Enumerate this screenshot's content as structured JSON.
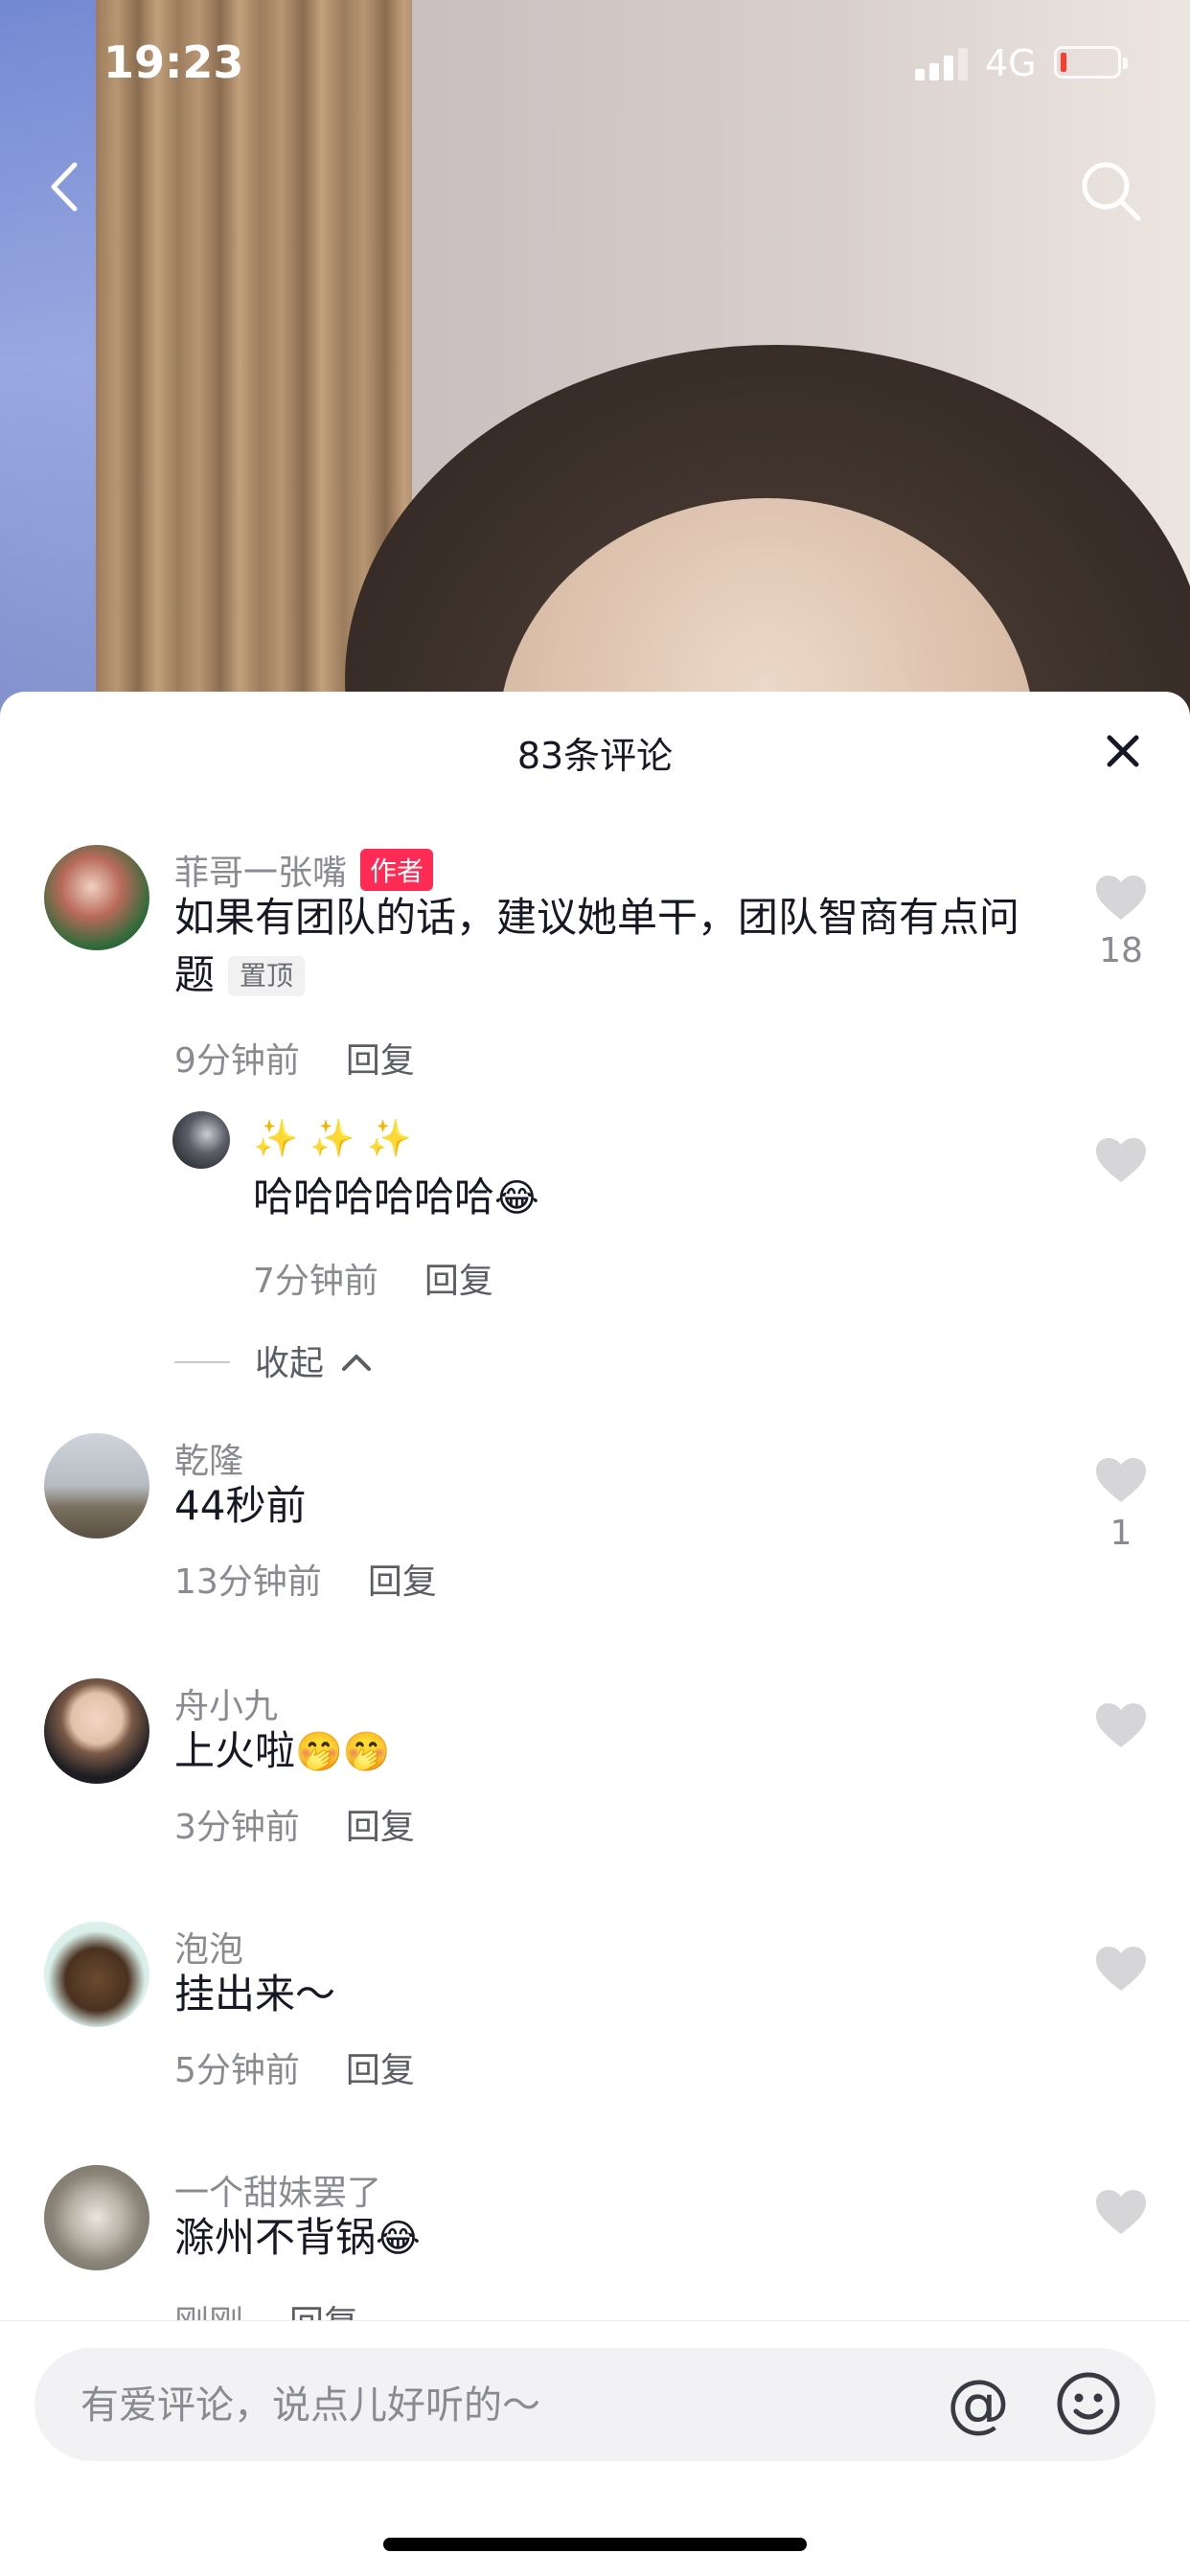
{
  "status_bar": {
    "time": "19:23",
    "network": "4G",
    "battery_level": 0.08,
    "battery_color": "#ff3b30"
  },
  "nav": {
    "back_icon": "chevron-left-icon",
    "search_icon": "search-icon"
  },
  "comments_panel": {
    "title": "83条评论",
    "close_icon": "close-icon",
    "collapse_label": "收起",
    "reply_label": "回复",
    "comments": [
      {
        "name": "菲哥一张嘴",
        "author_badge": "作者",
        "text": "如果有团队的话，建议她单干，团队智商有点问题",
        "pinned_badge": "置顶",
        "time": "9分钟前",
        "likes": "18",
        "replies": [
          {
            "name": "✨ ✨ ✨",
            "text": "哈哈哈哈哈哈",
            "emoji": "😂",
            "time": "7分钟前",
            "likes": ""
          }
        ]
      },
      {
        "name": "乾隆",
        "text": "44秒前",
        "emoji": "",
        "time": "13分钟前",
        "likes": "1"
      },
      {
        "name": "舟小九",
        "text": "上火啦",
        "emoji": "🤭🤭",
        "time": "3分钟前",
        "likes": ""
      },
      {
        "name": "泡泡",
        "text": "挂出来～",
        "emoji": "",
        "time": "5分钟前",
        "likes": ""
      },
      {
        "name": "一个甜妹罢了",
        "text": "滁州不背锅",
        "emoji": "😂",
        "time": "刚刚",
        "likes": ""
      }
    ]
  },
  "input_bar": {
    "placeholder": "有爱评论，说点儿好听的～",
    "at_label": "@",
    "emoji_icon": "smiley-icon"
  },
  "colors": {
    "accent": "#fe2c55",
    "text_primary": "#161823",
    "text_secondary": "#8a8b91"
  }
}
